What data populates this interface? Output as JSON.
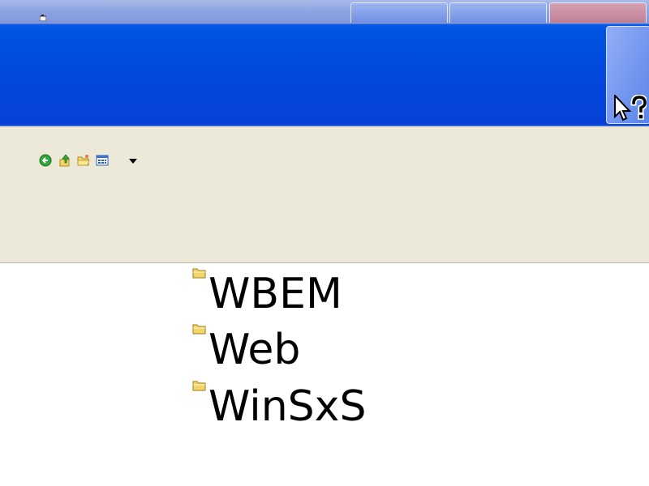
{
  "colors": {
    "title_strip": "#8ea5e2",
    "header_band": "#0346dc",
    "toolbar_bg": "#ece9d8",
    "list_bg": "#ffffff",
    "folder_yellow": "#f2d56b",
    "text": "#000000"
  },
  "title_bar": {
    "system_icon": "window-system-icon",
    "buttons": [
      {
        "name": "minimize-button",
        "icon": "minimize-icon"
      },
      {
        "name": "maximize-button",
        "icon": "maximize-icon"
      },
      {
        "name": "close-button",
        "icon": "close-icon"
      }
    ]
  },
  "header": {
    "help_button_icon": "help-cursor-icon"
  },
  "toolbar": {
    "buttons": [
      {
        "name": "back-button",
        "icon": "back-arrow-icon"
      },
      {
        "name": "up-button",
        "icon": "up-folder-icon"
      },
      {
        "name": "folders-button",
        "icon": "folders-icon"
      },
      {
        "name": "views-button",
        "icon": "views-icon"
      },
      {
        "name": "views-dropdown",
        "icon": "chevron-down-icon"
      }
    ]
  },
  "file_list": {
    "items": [
      {
        "label": "WBEM",
        "icon": "folder-icon"
      },
      {
        "label": "Web",
        "icon": "folder-icon"
      },
      {
        "label": "WinSxS",
        "icon": "folder-icon"
      }
    ]
  }
}
